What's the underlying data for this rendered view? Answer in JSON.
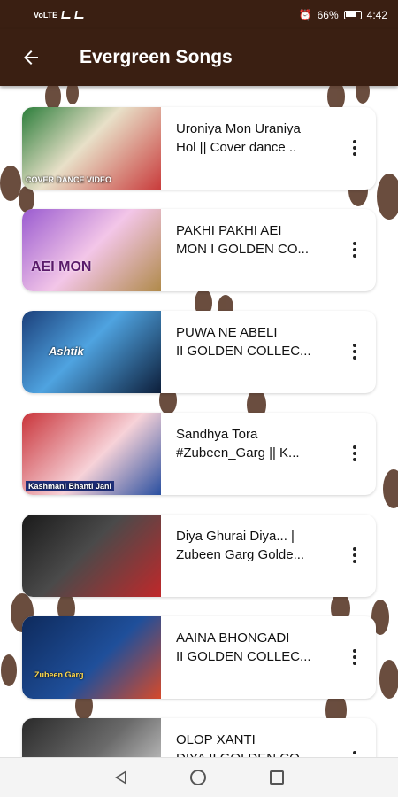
{
  "status_bar": {
    "left_text": "VoLTE",
    "battery_percent": "66%",
    "time": "4:42"
  },
  "app_bar": {
    "title": "Evergreen Songs"
  },
  "songs": [
    {
      "line1": "Uroniya Mon Uraniya",
      "line2": "Hol || Cover dance ..",
      "thumb_text": "COVER DANCE VIDEO",
      "thumb_colors": [
        "#2b7d3a",
        "#e8e0c8",
        "#c93c3c"
      ]
    },
    {
      "line1": "PAKHI PAKHI AEI",
      "line2": "MON I GOLDEN CO...",
      "thumb_text": "AEI MON",
      "thumb_colors": [
        "#9a5bd0",
        "#f3c6e8",
        "#b08a4a"
      ]
    },
    {
      "line1": "PUWA NE ABELI",
      "line2": "II GOLDEN COLLEC...",
      "thumb_text": "Ashtik",
      "thumb_colors": [
        "#1b3f7a",
        "#4fa3e0",
        "#0d1e3a"
      ]
    },
    {
      "line1": "Sandhya Tora",
      "line2": "#Zubeen_Garg || K...",
      "thumb_text": "Kashmani Bhanti Jani",
      "thumb_colors": [
        "#c9343a",
        "#f7d2d8",
        "#2a4fa0"
      ]
    },
    {
      "line1": "Diya Ghurai Diya... |",
      "line2": "Zubeen Garg Golde...",
      "thumb_text": "",
      "thumb_colors": [
        "#1a1a1a",
        "#4a4a4a",
        "#c0282a"
      ]
    },
    {
      "line1": "AAINA BHONGADI",
      "line2": "II GOLDEN COLLEC...",
      "thumb_text": "Zubeen Garg",
      "thumb_colors": [
        "#0e2a5c",
        "#1f4f9a",
        "#d64a2a"
      ]
    },
    {
      "line1": "OLOP XANTI",
      "line2": "DIYA II GOLDEN CO...",
      "thumb_text": "",
      "thumb_colors": [
        "#2a2a2a",
        "#6a6a6a",
        "#e0e0e0"
      ]
    }
  ]
}
